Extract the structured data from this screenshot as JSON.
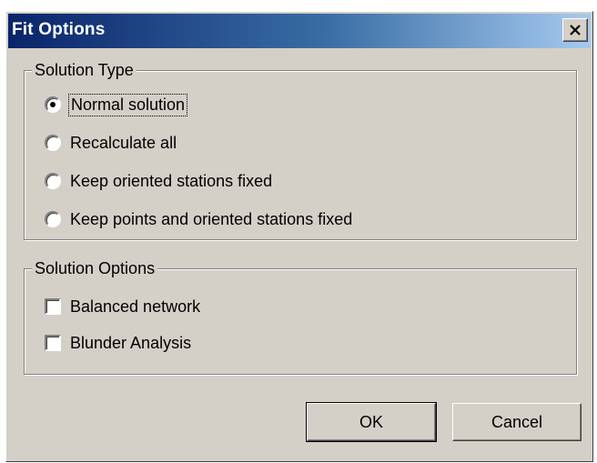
{
  "window": {
    "title": "Fit Options",
    "close_glyph": "×"
  },
  "solution_type": {
    "legend": "Solution Type",
    "options": [
      {
        "label": "Normal solution",
        "selected": true
      },
      {
        "label": "Recalculate all",
        "selected": false
      },
      {
        "label": "Keep oriented stations fixed",
        "selected": false
      },
      {
        "label": "Keep points and oriented stations fixed",
        "selected": false
      }
    ]
  },
  "solution_options": {
    "legend": "Solution Options",
    "checkboxes": [
      {
        "label": "Balanced network",
        "checked": false
      },
      {
        "label": "Blunder Analysis",
        "checked": false
      }
    ]
  },
  "buttons": {
    "ok_label": "OK",
    "cancel_label": "Cancel"
  },
  "colors": {
    "title_start": "#0a246a",
    "title_end": "#a6caf0",
    "face": "#d4d0c8"
  }
}
